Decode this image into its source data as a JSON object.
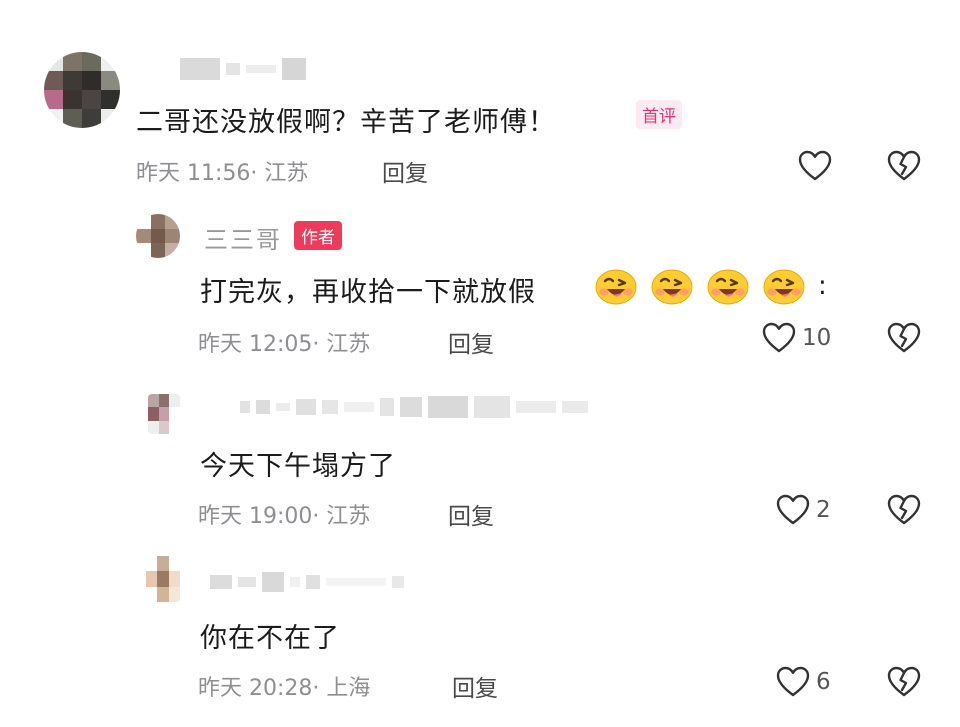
{
  "comments": [
    {
      "text": "二哥还没放假啊？辛苦了老师傅！",
      "badge": "首评",
      "time": "昨天 11:56",
      "location": "· 江苏",
      "reply": "回复",
      "likes": ""
    },
    {
      "author": "三三哥",
      "author_badge": "作者",
      "text": "打完灰，再收拾一下就放假",
      "emoji_suffix": ":",
      "emoji_name": "grinning-wink-emoji",
      "time": "昨天 12:05",
      "location": "· 江苏",
      "reply": "回复",
      "likes": "10"
    },
    {
      "text": "今天下午塌方了",
      "time": "昨天 19:00",
      "location": "· 江苏",
      "reply": "回复",
      "likes": "2"
    },
    {
      "text": "你在不在了",
      "time": "昨天 20:28",
      "location": "· 上海",
      "reply": "回复",
      "likes": "6"
    }
  ],
  "colors": {
    "badge_first": "#e8336d",
    "badge_author": "#ee3b5b",
    "meta_gray": "#8e8e93"
  },
  "icons": {
    "like": "heart-outline-icon",
    "dislike": "broken-heart-icon"
  }
}
